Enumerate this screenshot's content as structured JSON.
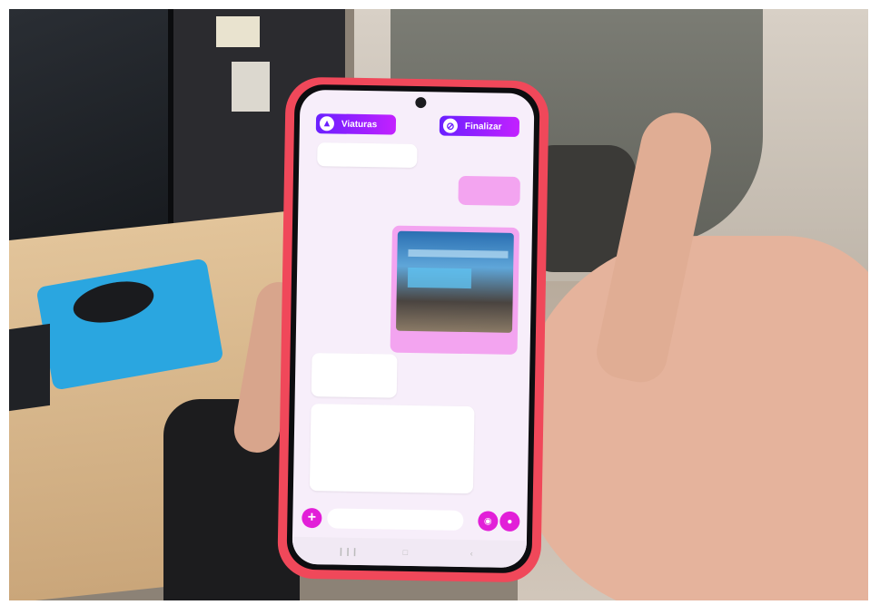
{
  "header": {
    "left_button_label": "Viaturas",
    "right_button_label": "Finalizar"
  },
  "messages": {
    "in_1": "",
    "out_1": "",
    "in_2_sender": "",
    "in_2_text": "",
    "in_3_sender": "",
    "in_3_text": ""
  },
  "composer": {
    "placeholder": ""
  },
  "colors": {
    "case": "#f0485a",
    "accent": "#e21fd8",
    "button_gradient_start": "#6a20ff",
    "button_gradient_end": "#c321ff",
    "outgoing_bubble": "#f3a4f0"
  },
  "icons": {
    "left_button_icon": "vehicle-icon",
    "right_button_icon": "block-icon",
    "attach": "plus-icon",
    "camera": "camera-icon",
    "mic": "mic-icon"
  }
}
